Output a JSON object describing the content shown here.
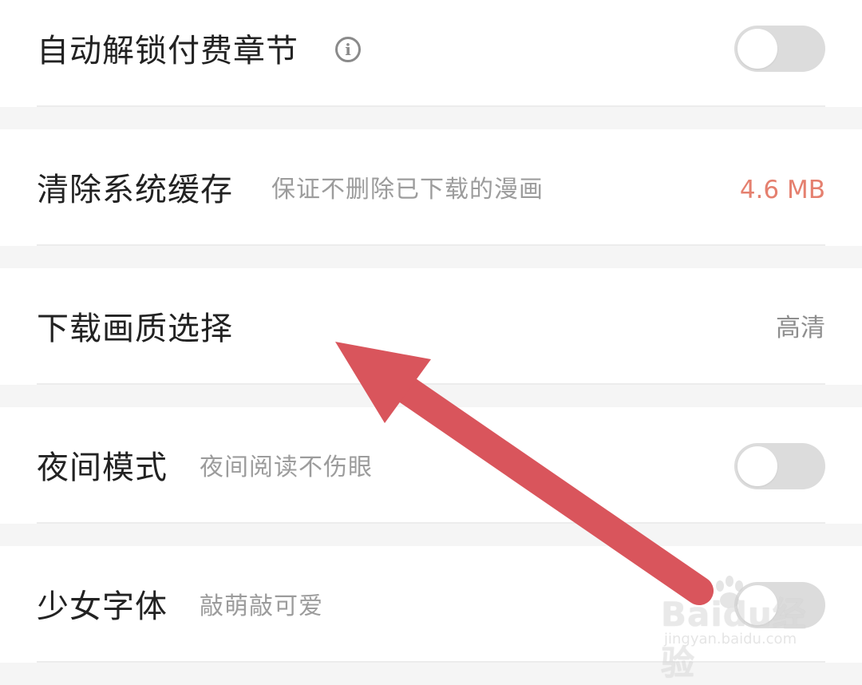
{
  "settings": {
    "auto_unlock": {
      "title": "自动解锁付费章节",
      "info_icon": "i",
      "toggle_on": false
    },
    "clear_cache": {
      "title": "清除系统缓存",
      "subtitle": "保证不删除已下载的漫画",
      "value": "4.6 MB",
      "value_color": "#e5806f"
    },
    "download_quality": {
      "title": "下载画质选择",
      "value": "高清"
    },
    "night_mode": {
      "title": "夜间模式",
      "subtitle": "夜间阅读不伤眼",
      "toggle_on": false
    },
    "girl_font": {
      "title": "少女字体",
      "subtitle": "敲萌敲可爱",
      "toggle_on": false
    }
  },
  "overlay": {
    "arrow_color": "#d9555c"
  },
  "watermark": {
    "brand": "Baidu",
    "brand_suffix": "经验",
    "url": "jingyan.baidu.com"
  },
  "colors": {
    "toggle_off": "#dcdcdc",
    "page_bg": "#f5f5f5"
  }
}
